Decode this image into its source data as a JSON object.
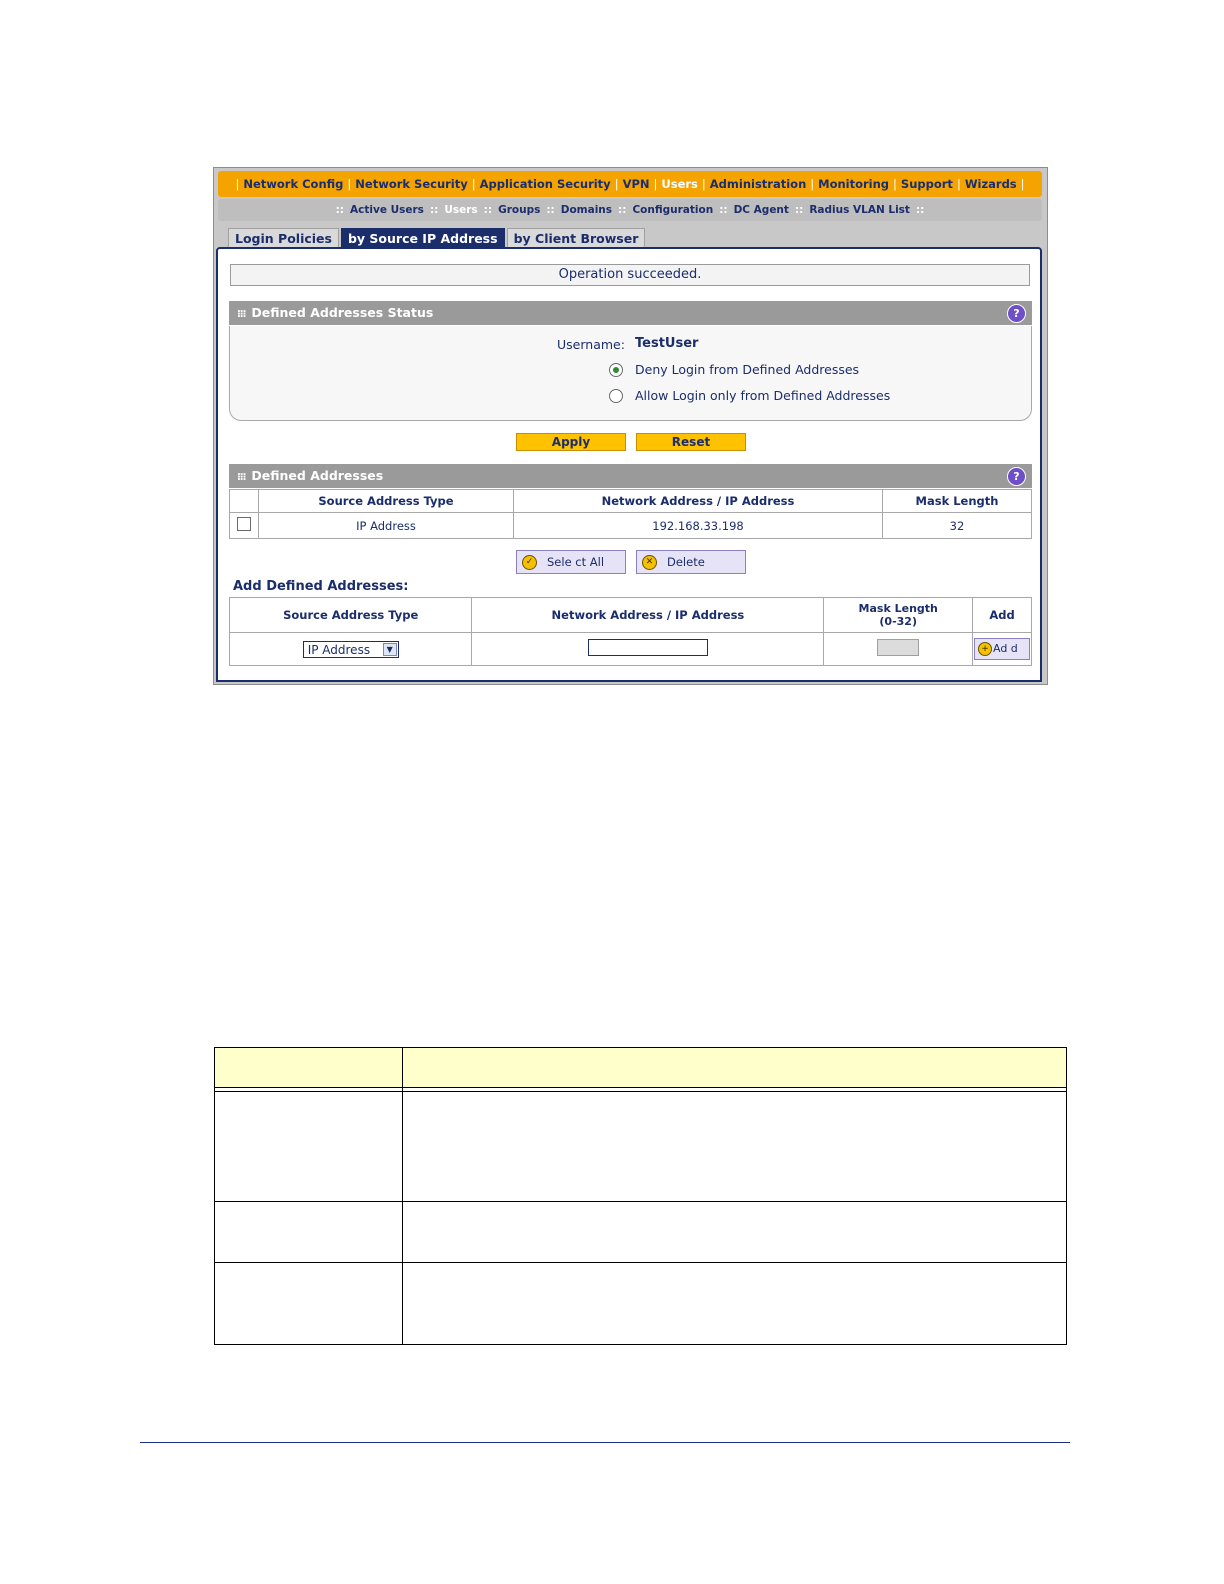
{
  "topnav": {
    "items": [
      "Network Config",
      "Network Security",
      "Application Security",
      "VPN",
      "Users",
      "Administration",
      "Monitoring",
      "Support",
      "Wizards"
    ]
  },
  "subnav": {
    "items": [
      "Active Users",
      "Users",
      "Groups",
      "Domains",
      "Configuration",
      "DC Agent",
      "Radius VLAN List"
    ]
  },
  "tabs": [
    "Login Policies",
    "by Source IP Address",
    "by Client Browser"
  ],
  "status_message": "Operation succeeded.",
  "defined_status": {
    "title": "Defined Addresses Status",
    "username_label": "Username:",
    "username_value": "TestUser",
    "radio_deny": "Deny Login from Defined Addresses",
    "radio_allow": "Allow Login only from Defined Addresses",
    "selected": "deny"
  },
  "buttons": {
    "apply": "Apply",
    "reset": "Reset",
    "select_all": "Sele ct All",
    "delete": "Delete",
    "add": "Ad d"
  },
  "defined_addresses": {
    "title": "Defined Addresses",
    "columns": [
      "Source Address Type",
      "Network Address / IP Address",
      "Mask Length"
    ],
    "rows": [
      {
        "type": "IP Address",
        "address": "192.168.33.198",
        "mask": "32"
      }
    ]
  },
  "add_section": {
    "title": "Add Defined Addresses:",
    "col_type": "Source Address Type",
    "col_address": "Network Address / IP Address",
    "col_mask": "Mask Length",
    "col_mask_range": "(0-32)",
    "col_add": "Add",
    "select_value": "IP Address"
  },
  "colors": {
    "brand": "#1b2d6b",
    "nav_orange": "#f4a300",
    "button_yellow": "#ffc200",
    "table_header": "#ffffcc"
  }
}
